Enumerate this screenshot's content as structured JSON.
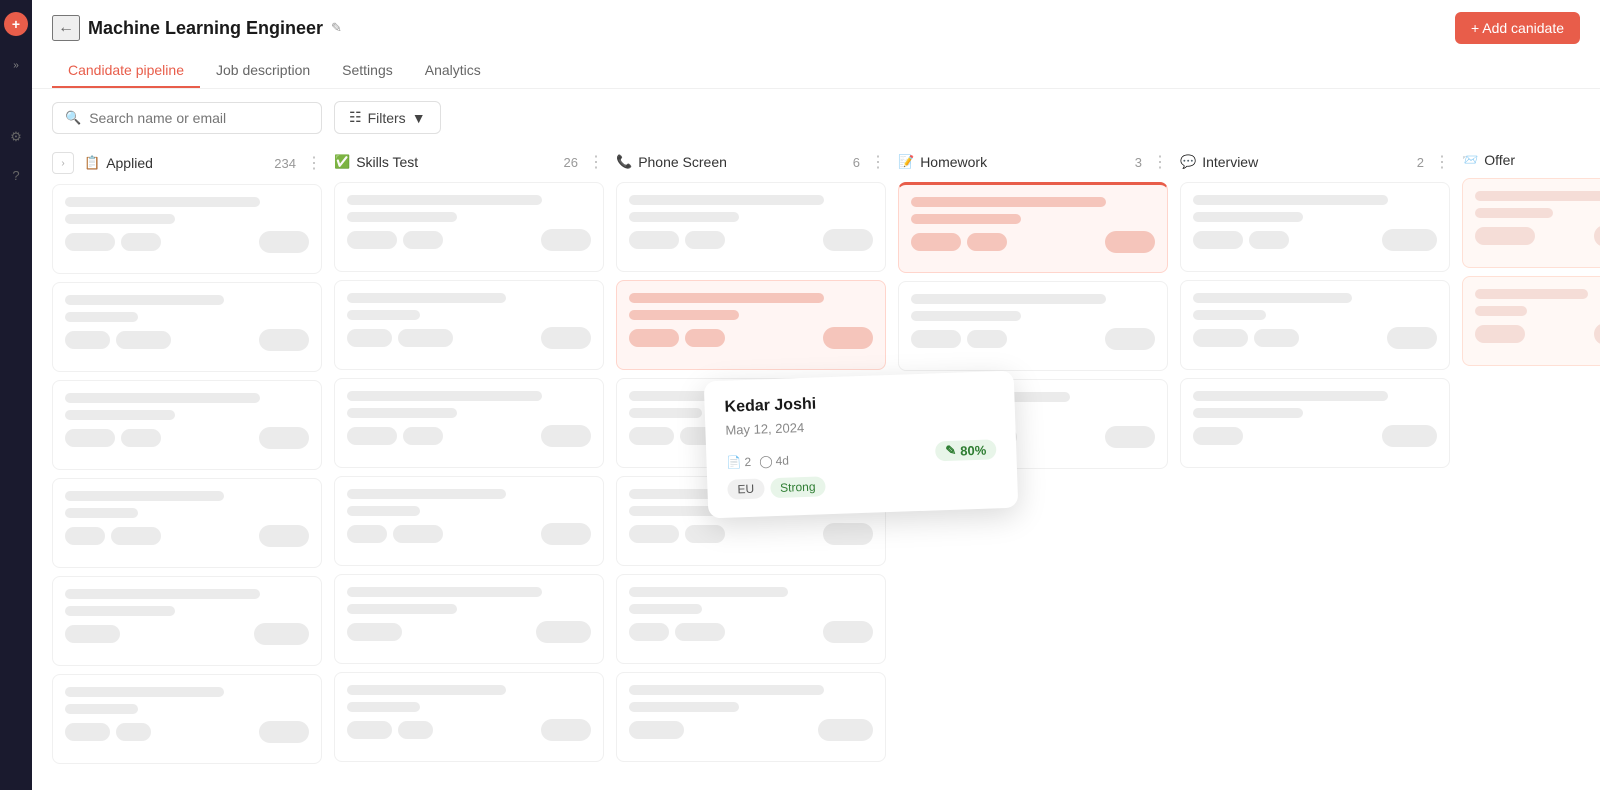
{
  "app": {
    "title": "Machine Learning Engineer",
    "add_candidate_label": "+ Add canidate"
  },
  "tabs": [
    {
      "id": "pipeline",
      "label": "Candidate pipeline",
      "active": true
    },
    {
      "id": "job",
      "label": "Job description",
      "active": false
    },
    {
      "id": "settings",
      "label": "Settings",
      "active": false
    },
    {
      "id": "analytics",
      "label": "Analytics",
      "active": false
    }
  ],
  "toolbar": {
    "search_placeholder": "Search name or email",
    "filter_label": "Filters"
  },
  "columns": [
    {
      "id": "applied",
      "title": "Applied",
      "count": "234",
      "icon": "📋",
      "color": "#5b8ff9"
    },
    {
      "id": "skills_test",
      "title": "Skills Test",
      "count": "26",
      "icon": "✅",
      "color": "#52c41a"
    },
    {
      "id": "phone_screen",
      "title": "Phone Screen",
      "count": "6",
      "icon": "📞",
      "color": "#fa8c16"
    },
    {
      "id": "homework",
      "title": "Homework",
      "count": "3",
      "icon": "📝",
      "color": "#fa8c16"
    },
    {
      "id": "interview",
      "title": "Interview",
      "count": "2",
      "icon": "💬",
      "color": "#666"
    },
    {
      "id": "offer",
      "title": "Offer",
      "count": "",
      "icon": "📨",
      "color": "#666"
    }
  ],
  "hover_card": {
    "name": "Kedar Joshi",
    "date": "May 12, 2024",
    "score": "80%",
    "score_icon": "✏️",
    "meta_count": "2",
    "meta_time": "4d",
    "tags": [
      "EU",
      "Strong"
    ]
  }
}
